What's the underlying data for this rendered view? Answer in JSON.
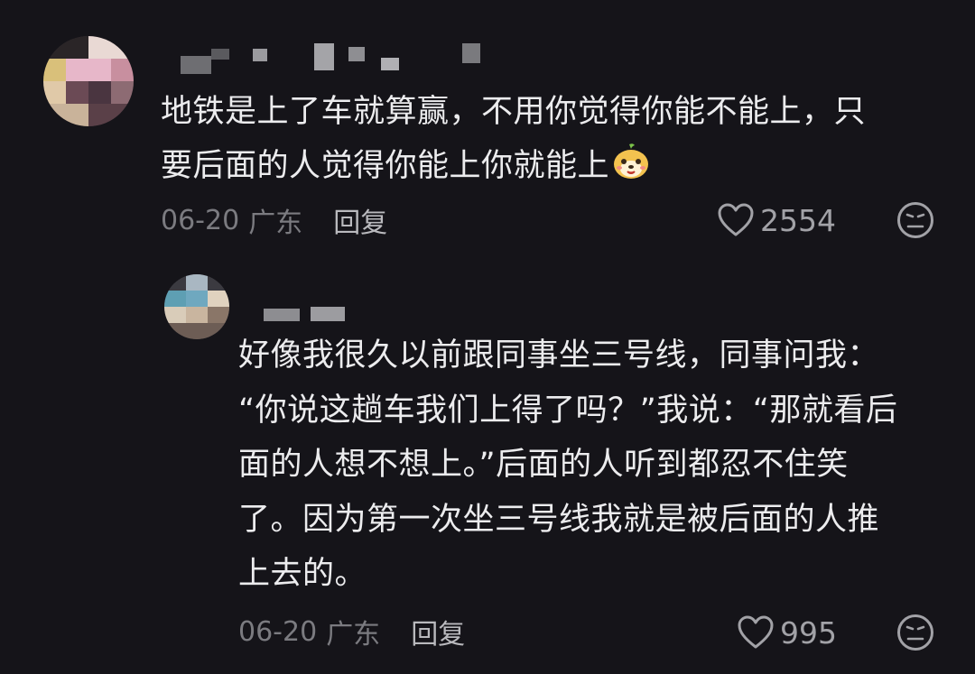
{
  "comments": [
    {
      "text_line1": "地铁是上了车就算赢，不用你觉得你能不能上，只",
      "text_line2": "要后面的人觉得你能上你就能上",
      "emoji": "puppy-face-emoji",
      "date": "06-20",
      "location": "广东",
      "reply_label": "回复",
      "likes": "2554",
      "dislike_icon": "frown-face-icon"
    },
    {
      "lines": [
        "好像我很久以前跟同事坐三号线，同事问我：",
        "“你说这趟车我们上得了吗？”我说：“那就看后",
        "面的人想不想上。”后面的人听到都忍不住笑",
        "了。因为第一次坐三号线我就是被后面的人推",
        "上去的。"
      ],
      "date": "06-20",
      "location": "广东",
      "reply_label": "回复",
      "likes": "995",
      "dislike_icon": "frown-face-icon"
    }
  ],
  "icons": {
    "like": "heart-outline-icon"
  },
  "colors": {
    "background": "#151419",
    "text": "#ececee",
    "meta": "#7b7b80",
    "icon": "#a2a2a7"
  }
}
